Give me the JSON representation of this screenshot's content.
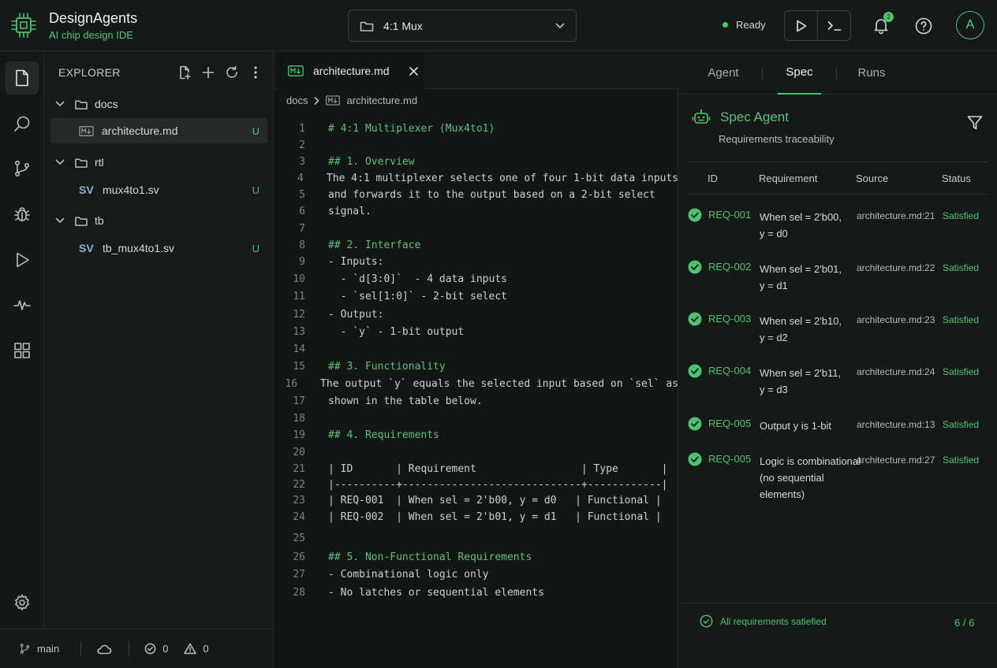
{
  "app": {
    "name": "DesignAgents",
    "subtitle": "AI chip design IDE"
  },
  "header": {
    "project": "4:1 Mux",
    "status": "Ready",
    "notification_count": "2",
    "avatar_initial": "A"
  },
  "explorer": {
    "title": "EXPLORER",
    "tree": [
      {
        "type": "folder",
        "name": "docs"
      },
      {
        "type": "file",
        "icon": "md",
        "name": "architecture.md",
        "badge": "U",
        "selected": true
      },
      {
        "type": "folder",
        "name": "rtl"
      },
      {
        "type": "file",
        "icon": "SV",
        "name": "mux4to1.sv",
        "badge": "U"
      },
      {
        "type": "folder",
        "name": "tb"
      },
      {
        "type": "file",
        "icon": "SV",
        "name": "tb_mux4to1.sv",
        "badge": "U"
      }
    ]
  },
  "statusbar": {
    "branch": "main",
    "errors": "0",
    "warnings": "0"
  },
  "editor": {
    "tab": "architecture.md",
    "breadcrumb": [
      "docs",
      "architecture.md"
    ],
    "lines": [
      {
        "n": "1",
        "t": "# 4:1 Multiplexer (Mux4to1)",
        "h": true
      },
      {
        "n": "2",
        "t": ""
      },
      {
        "n": "3",
        "t": "## 1. Overview",
        "h": true
      },
      {
        "n": "4",
        "t": "The 4:1 multiplexer selects one of four 1-bit data inputs"
      },
      {
        "n": "5",
        "t": "and forwards it to the output based on a 2-bit select"
      },
      {
        "n": "6",
        "t": "signal."
      },
      {
        "n": "7",
        "t": ""
      },
      {
        "n": "8",
        "t": "## 2. Interface",
        "h": true
      },
      {
        "n": "9",
        "t": "- Inputs:"
      },
      {
        "n": "10",
        "t": "  - `d[3:0]`  - 4 data inputs"
      },
      {
        "n": "11",
        "t": "  - `sel[1:0]` - 2-bit select"
      },
      {
        "n": "12",
        "t": "- Output:"
      },
      {
        "n": "13",
        "t": "  - `y` - 1-bit output"
      },
      {
        "n": "14",
        "t": ""
      },
      {
        "n": "15",
        "t": "## 3. Functionality",
        "h": true
      },
      {
        "n": "16",
        "t": "The output `y` equals the selected input based on `sel` as"
      },
      {
        "n": "17",
        "t": "shown in the table below."
      },
      {
        "n": "18",
        "t": ""
      },
      {
        "n": "19",
        "t": "## 4. Requirements",
        "h": true
      },
      {
        "n": "20",
        "t": ""
      },
      {
        "n": "21",
        "t": "| ID       | Requirement                 | Type       |"
      },
      {
        "n": "22",
        "t": "|----------+-----------------------------+------------|"
      },
      {
        "n": "23",
        "t": "| REQ-001  | When sel = 2'b00, y = d0   | Functional |"
      },
      {
        "n": "24",
        "t": "| REQ-002  | When sel = 2'b01, y = d1   | Functional |"
      },
      {
        "n": "25",
        "t": ""
      },
      {
        "n": "26",
        "t": "## 5. Non-Functional Requirements",
        "h": true
      },
      {
        "n": "27",
        "t": "- Combinational logic only"
      },
      {
        "n": "28",
        "t": "- No latches or sequential elements"
      }
    ]
  },
  "panel": {
    "tabs": [
      "Agent",
      "Spec",
      "Runs"
    ],
    "active_tab": "Spec",
    "agent_title": "Spec Agent",
    "agent_subtitle": "Requirements traceability",
    "columns": [
      "ID",
      "Requirement",
      "Source",
      "Status"
    ],
    "requirements": [
      {
        "id": "REQ-001",
        "text": "When sel = 2'b00,\ny = d0",
        "source": "architecture.md:21",
        "status": "Satisfied"
      },
      {
        "id": "REQ-002",
        "text": "When sel = 2'b01,\ny = d1",
        "source": "architecture.md:22",
        "status": "Satisfied"
      },
      {
        "id": "REQ-003",
        "text": "When sel = 2'b10,\ny = d2",
        "source": "architecture.md:23",
        "status": "Satisfied"
      },
      {
        "id": "REQ-004",
        "text": "When sel = 2'b11,\ny = d3",
        "source": "architecture.md:24",
        "status": "Satisfied"
      },
      {
        "id": "REQ-005",
        "text": "Output y is 1-bit",
        "source": "architecture.md:13",
        "status": "Satisfied"
      },
      {
        "id": "REQ-005",
        "text": "Logic is combinational\n(no sequential elements)",
        "source": "architecture.md:27",
        "status": "Satisfied"
      }
    ],
    "footer_message": "All requirements satiefied",
    "footer_count": "6 / 6"
  },
  "colors": {
    "accent": "#4cc46f",
    "background": "#121614",
    "panel": "#151917"
  }
}
